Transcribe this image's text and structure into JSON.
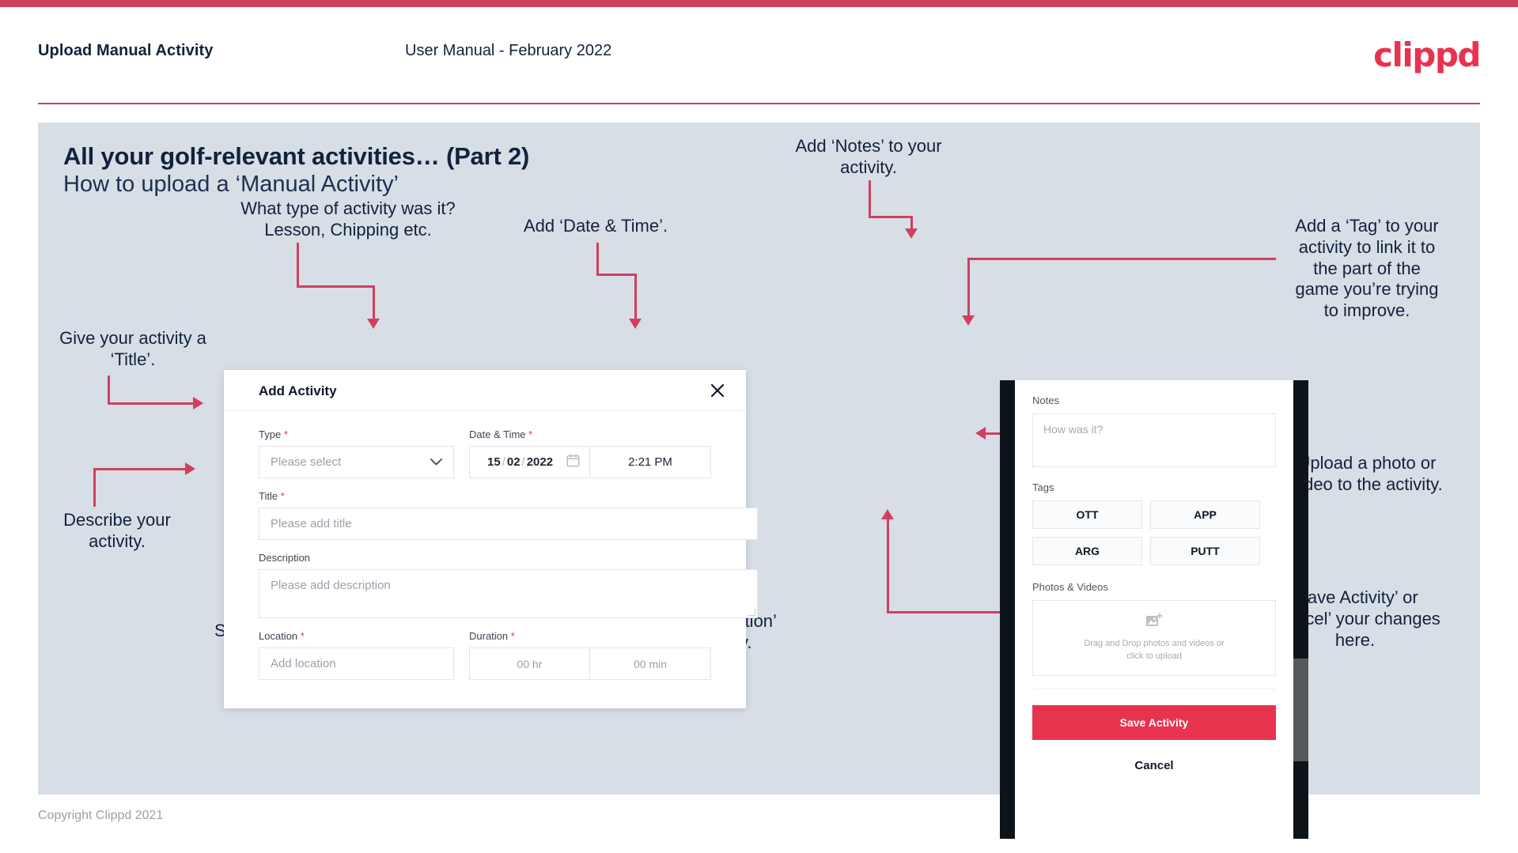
{
  "header": {
    "title": "Upload Manual Activity",
    "subtitle": "User Manual - February 2022",
    "logo": "clippd"
  },
  "slide": {
    "title": "All your golf-relevant activities… (Part 2)",
    "subtitle": "How to upload a ‘Manual Activity’"
  },
  "annotations": {
    "type": "What type of activity was it?\nLesson, Chipping etc.",
    "datetime": "Add ‘Date & Time’.",
    "title": "Give your activity a\n‘Title’.",
    "description": "Describe your\nactivity.",
    "location": "Specify the ‘Location’.",
    "duration": "Specify the ‘Duration’\nof your activity.",
    "notes": "Add ‘Notes’ to your\nactivity.",
    "tags": "Add a ‘Tag’ to your\nactivity to link it to\nthe part of the\ngame you’re trying\nto improve.",
    "photos": "Upload a photo or\nvideo to the activity.",
    "save": "‘Save Activity’ or\n‘Cancel’ your changes\nhere."
  },
  "dialog": {
    "title": "Add Activity",
    "close_icon": "close-icon",
    "fields": {
      "type": {
        "label": "Type",
        "required": "*",
        "placeholder": "Please select",
        "chevron_icon": "chevron-down-icon"
      },
      "datetime": {
        "label": "Date & Time",
        "required": "*",
        "day": "15",
        "sep1": "/",
        "month": "02",
        "sep2": "/",
        "year": "2022",
        "calendar_icon": "calendar-icon",
        "time": "2:21 PM"
      },
      "title": {
        "label": "Title",
        "required": "*",
        "placeholder": "Please add title"
      },
      "description": {
        "label": "Description",
        "required": "",
        "placeholder": "Please add description"
      },
      "location": {
        "label": "Location",
        "required": "*",
        "placeholder": "Add location"
      },
      "duration": {
        "label": "Duration",
        "required": "*",
        "hours_placeholder": "00 hr",
        "minutes_placeholder": "00 min"
      }
    }
  },
  "mobile": {
    "notes_label": "Notes",
    "notes_placeholder": "How was it?",
    "tags_label": "Tags",
    "tags": [
      "OTT",
      "APP",
      "ARG",
      "PUTT"
    ],
    "photos_label": "Photos & Videos",
    "dropzone_icon": "add-photo-icon",
    "dropzone_line1": "Drag and Drop photos and videos or",
    "dropzone_line2": "click to upload",
    "save_label": "Save Activity",
    "cancel_label": "Cancel"
  },
  "footer": {
    "copyright": "Copyright Clippd 2021"
  },
  "colors": {
    "accent": "#cf4060",
    "brand": "#e8334f",
    "slide_bg": "#d7dee6",
    "text_dark": "#12223c"
  }
}
